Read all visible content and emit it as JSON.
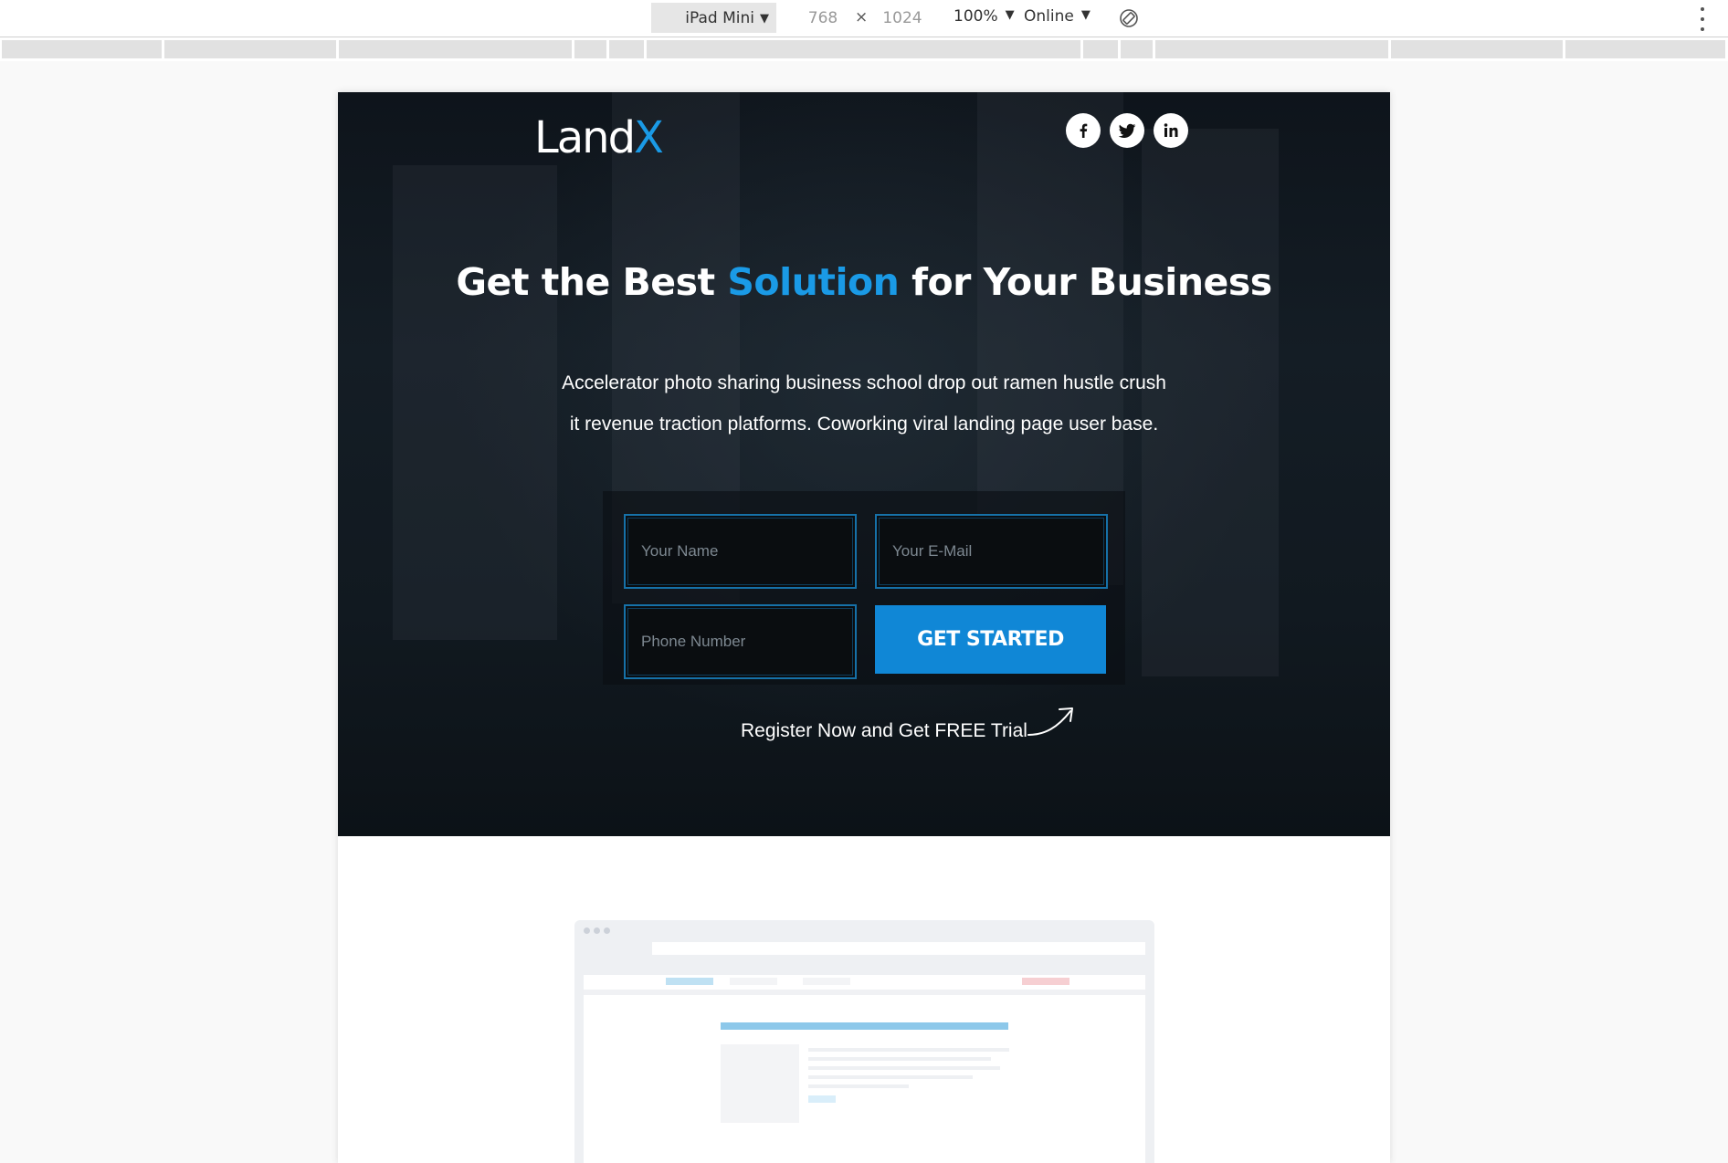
{
  "devtools": {
    "device": "iPad Mini",
    "width": "768",
    "times": "×",
    "height": "1024",
    "zoom": "100%",
    "network": "Online"
  },
  "hero": {
    "logo_main": "Land",
    "logo_accent": "X",
    "headline_part1": "Get the Best ",
    "headline_accent": "Solution",
    "headline_part2": " for Your ",
    "headline_bold": "Business",
    "subtext_line1": "Accelerator photo sharing business school drop out ramen hustle crush",
    "subtext_line2": "it revenue traction platforms. Coworking viral landing page user base.",
    "form": {
      "name_placeholder": "Your Name",
      "email_placeholder": "Your E-Mail",
      "phone_placeholder": "Phone Number",
      "submit_label": "GET STARTED"
    },
    "register_text": "Register Now and Get FREE Trial"
  },
  "social": [
    "facebook-icon",
    "twitter-icon",
    "linkedin-icon"
  ],
  "colors": {
    "accent": "#1a9ae6",
    "button": "#1087d6",
    "hero_bg": "#111920"
  }
}
